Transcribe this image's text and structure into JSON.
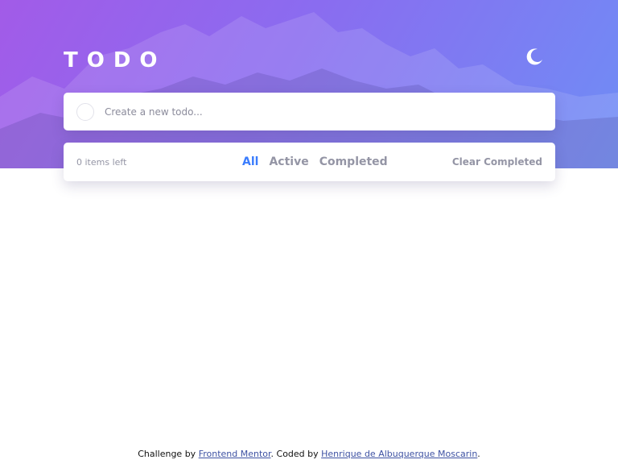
{
  "header": {
    "title": "TODO",
    "theme_icon": "moon-icon"
  },
  "new_todo": {
    "placeholder": "Create a new todo..."
  },
  "filters": {
    "items_left": "0 items left",
    "options": [
      "All",
      "Active",
      "Completed"
    ],
    "selected": "All",
    "clear_label": "Clear Completed"
  },
  "footer": {
    "prefix": "Challenge by ",
    "challenge_link": "Frontend Mentor",
    "middle": ". Coded by ",
    "author_link": "Henrique de Albuquerque Moscarin",
    "suffix": "."
  },
  "colors": {
    "accent": "#3a7cfd",
    "gradient_start": "#a25be8",
    "gradient_end": "#6f8df5",
    "muted_text": "#9495a5"
  }
}
